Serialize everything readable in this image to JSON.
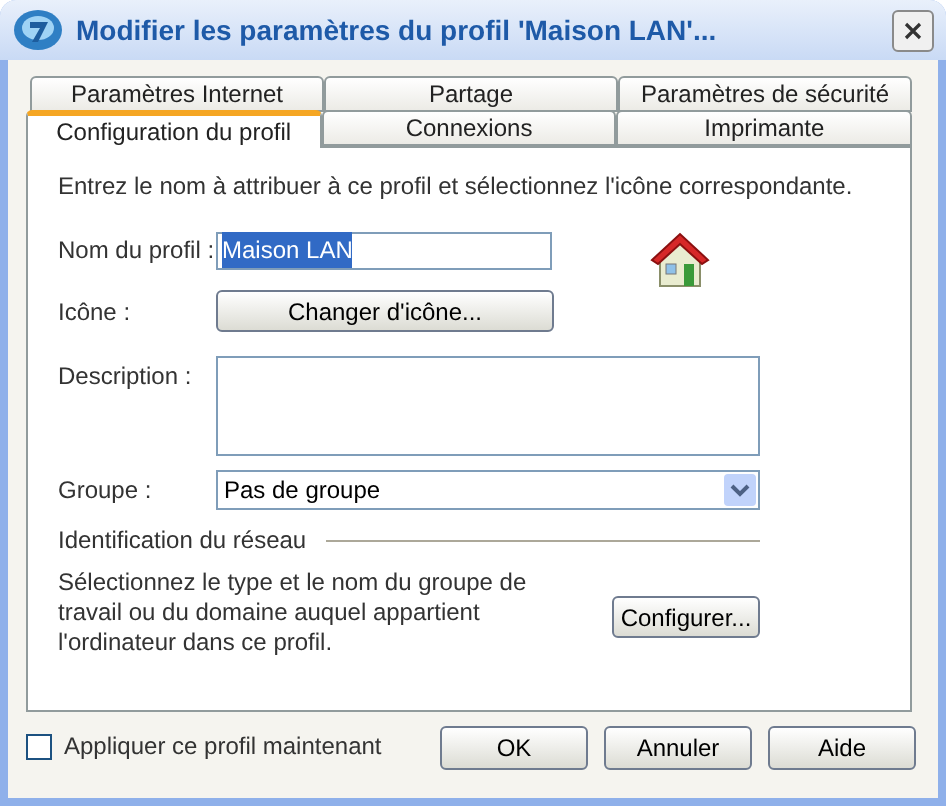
{
  "window": {
    "title": "Modifier les paramètres du profil 'Maison LAN'..."
  },
  "tab_rows": [
    [
      {
        "label": "Paramètres Internet",
        "selected": false
      },
      {
        "label": "Partage",
        "selected": false
      },
      {
        "label": "Paramètres de sécurité",
        "selected": false
      }
    ],
    [
      {
        "label": "Configuration du profil",
        "selected": true
      },
      {
        "label": "Connexions",
        "selected": false
      },
      {
        "label": "Imprimante",
        "selected": false
      }
    ]
  ],
  "intro": "Entrez le nom à attribuer à ce profil et sélectionnez l'icône correspondante.",
  "profile_name": {
    "label": "Nom du profil :",
    "value": "Maison LAN",
    "highlighted": true
  },
  "icon": {
    "label": "Icône :",
    "button": "Changer d'icône..."
  },
  "description": {
    "label": "Description :"
  },
  "group": {
    "label": "Groupe :",
    "value": "Pas de groupe"
  },
  "network": {
    "heading": "Identification du réseau",
    "text": "Sélectionnez le type et le nom du groupe de travail ou du domaine auquel appartient l'ordinateur dans ce profil.",
    "button": "Configurer..."
  },
  "apply_now": {
    "label": "Appliquer ce profil maintenant",
    "checked": false
  },
  "buttons": [
    "OK",
    "Annuler",
    "Aide"
  ]
}
